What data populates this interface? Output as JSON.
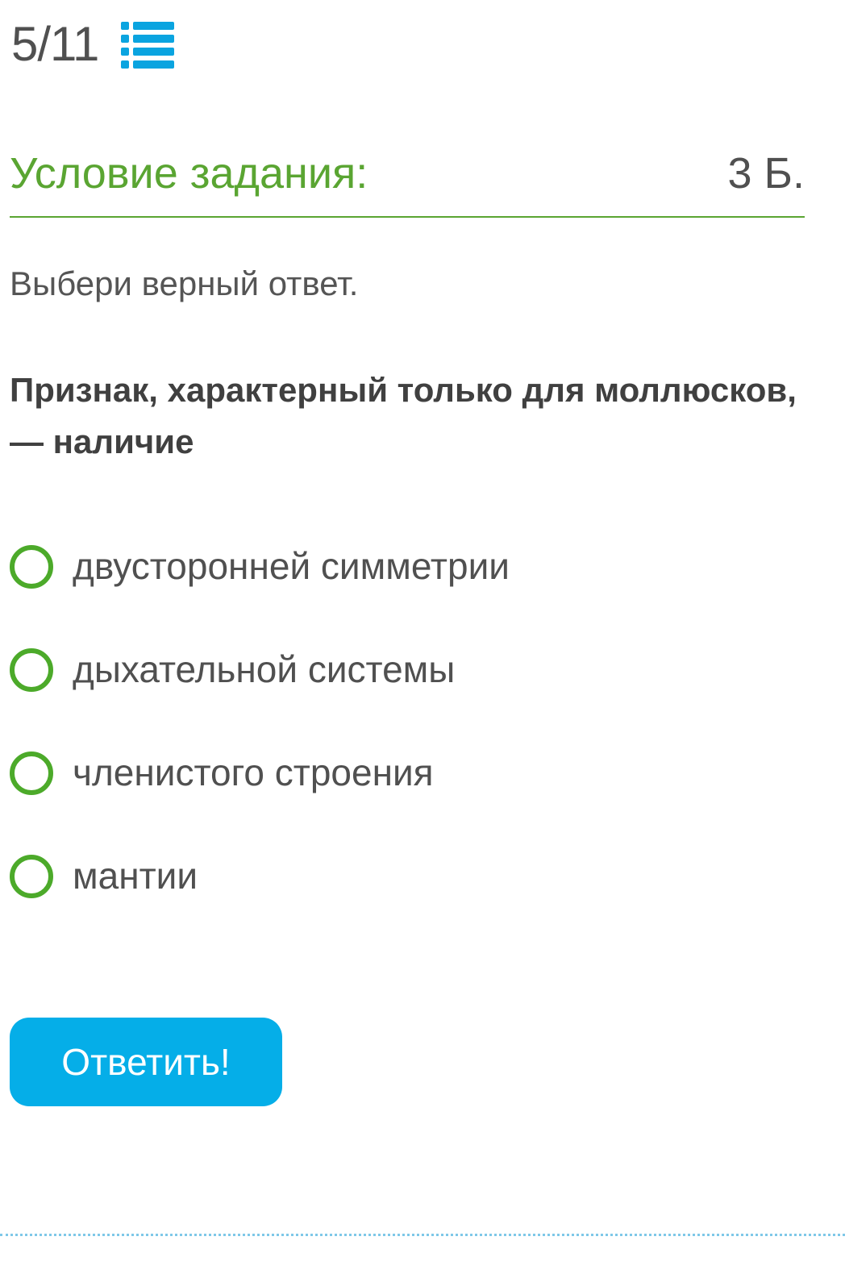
{
  "progress": {
    "counter": "5/11",
    "list_icon": "list-icon"
  },
  "task": {
    "title": "Условие задания:",
    "points": "3 Б."
  },
  "instruction": "Выбери верный ответ.",
  "question": "Признак, характерный только для моллюсков, — наличие",
  "options": [
    {
      "label": "двусторонней симметрии",
      "selected": false
    },
    {
      "label": "дыхательной системы",
      "selected": false
    },
    {
      "label": "членистого строения",
      "selected": false
    },
    {
      "label": "мантии",
      "selected": false
    }
  ],
  "submit_label": "Ответить!",
  "colors": {
    "accent_green": "#5aa532",
    "radio_green": "#4caa2a",
    "button_blue": "#05aee8",
    "icon_blue": "#0aa4e0"
  }
}
